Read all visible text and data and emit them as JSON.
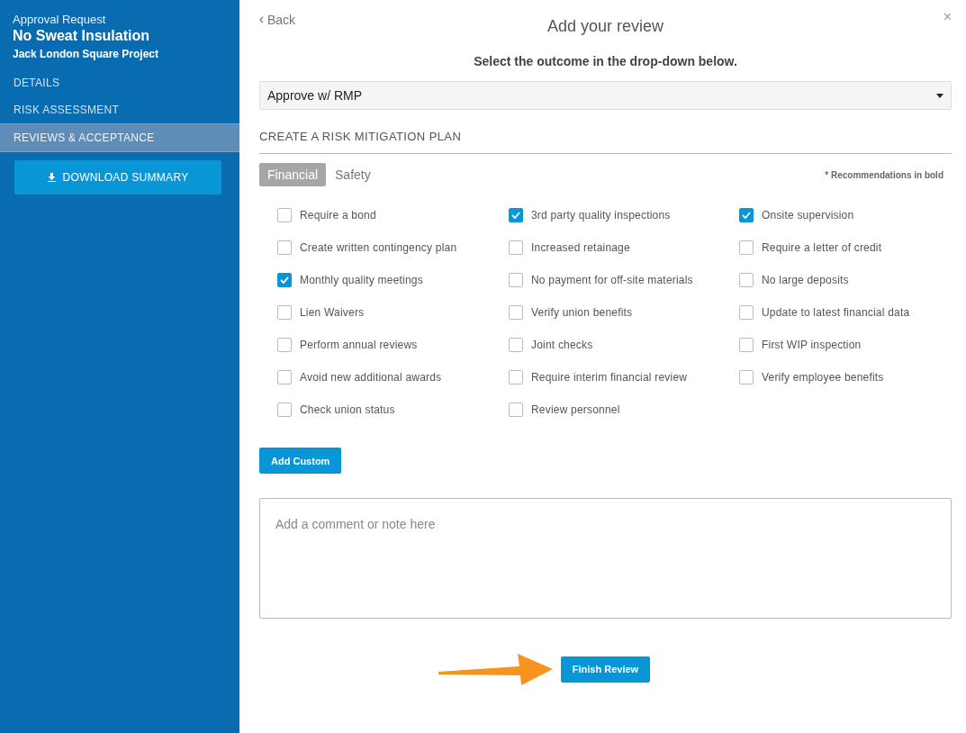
{
  "sidebar": {
    "eyebrow": "Approval Request",
    "title": "No Sweat Insulation",
    "subtitle": "Jack London Square Project",
    "nav": [
      {
        "label": "DETAILS",
        "selected": false
      },
      {
        "label": "RISK ASSESSMENT",
        "selected": false
      },
      {
        "label": "REVIEWS & ACCEPTANCE",
        "selected": true
      }
    ],
    "download_button": "DOWNLOAD SUMMARY"
  },
  "header": {
    "back": "Back",
    "title": "Add your review",
    "close": "×"
  },
  "instruction": "Select the outcome in the drop-down below.",
  "outcome_dropdown": {
    "value": "Approve w/ RMP"
  },
  "risk_plan": {
    "heading": "CREATE A RISK MITIGATION PLAN",
    "tabs": [
      {
        "label": "Financial",
        "selected": true
      },
      {
        "label": "Safety",
        "selected": false
      }
    ],
    "note": "* Recommendations in bold",
    "items": [
      {
        "label": "Require a bond",
        "checked": false
      },
      {
        "label": "3rd party quality inspections",
        "checked": true
      },
      {
        "label": "Onsite supervision",
        "checked": true
      },
      {
        "label": "Create written contingency plan",
        "checked": false
      },
      {
        "label": "Increased retainage",
        "checked": false
      },
      {
        "label": "Require a letter of credit",
        "checked": false
      },
      {
        "label": "Monthly quality meetings",
        "checked": true
      },
      {
        "label": "No payment for off-site materials",
        "checked": false
      },
      {
        "label": "No large deposits",
        "checked": false
      },
      {
        "label": "Lien Waivers",
        "checked": false
      },
      {
        "label": "Verify union benefits",
        "checked": false
      },
      {
        "label": "Update to latest financial data",
        "checked": false
      },
      {
        "label": "Perform annual reviews",
        "checked": false
      },
      {
        "label": "Joint checks",
        "checked": false
      },
      {
        "label": "First WIP inspection",
        "checked": false
      },
      {
        "label": "Avoid new additional awards",
        "checked": false
      },
      {
        "label": "Require interim financial review",
        "checked": false
      },
      {
        "label": "Verify employee benefits",
        "checked": false
      },
      {
        "label": "Check union status",
        "checked": false
      },
      {
        "label": "Review personnel",
        "checked": false
      }
    ],
    "add_button": "Add Custom"
  },
  "comment": {
    "placeholder": "Add a comment or note here"
  },
  "finish_button": "Finish Review"
}
